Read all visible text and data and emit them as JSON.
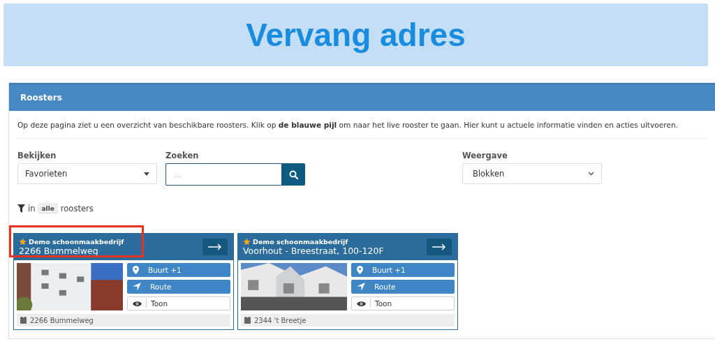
{
  "banner": {
    "title": "Vervang adres"
  },
  "panel": {
    "title": "Roosters",
    "intro": "Op deze pagina ziet u een overzicht van beschikbare roosters. Klik op **de blauwe pijl** om naar het live rooster te gaan. Hier kunt u actuele informatie vinden en acties uitvoeren."
  },
  "filters": {
    "view": {
      "label": "Bekijken",
      "value": "Favorieten"
    },
    "search": {
      "label": "Zoeken",
      "placeholder": "..."
    },
    "display": {
      "label": "Weergave",
      "value": "Blokken"
    }
  },
  "filter_note": {
    "prefix": "in",
    "tag": "alle",
    "suffix": "roosters"
  },
  "cards": [
    {
      "company": "Demo schoonmaakbedrijf",
      "favorite": true,
      "address": "2266 Bummelweg",
      "highlighted": true,
      "actions": [
        {
          "kind": "pin",
          "label": "Buurt +1",
          "primary": true
        },
        {
          "kind": "route",
          "label": "Route",
          "primary": true
        },
        {
          "kind": "eye",
          "label": "Toon",
          "primary": false
        }
      ],
      "footer": "2266 Bummelweg"
    },
    {
      "company": "Demo schoonmaakbedrijf",
      "favorite": true,
      "address": "Voorhout - Breestraat, 100-120F",
      "highlighted": false,
      "actions": [
        {
          "kind": "pin",
          "label": "Buurt +1",
          "primary": true
        },
        {
          "kind": "route",
          "label": "Route",
          "primary": true
        },
        {
          "kind": "eye",
          "label": "Toon",
          "primary": false
        }
      ],
      "footer": "2344 't Breetje"
    }
  ]
}
